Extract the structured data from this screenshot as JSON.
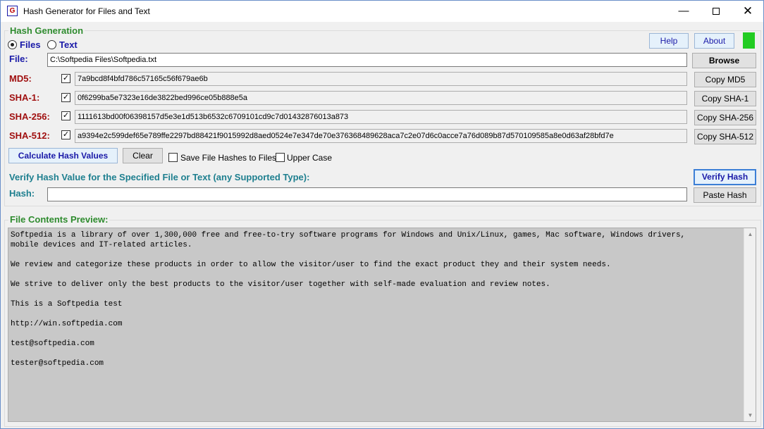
{
  "window": {
    "title": "Hash Generator for Files and Text",
    "icon_char": "G",
    "minimize": "—",
    "close": "✕"
  },
  "hash_generation": {
    "group_title": "Hash Generation",
    "mode_files": "Files",
    "mode_text": "Text",
    "help_label": "Help",
    "about_label": "About",
    "file_label": "File:",
    "file_value": "C:\\Softpedia Files\\Softpedia.txt",
    "browse_label": "Browse",
    "rows": [
      {
        "label": "MD5:",
        "checked": "✓",
        "value": "7a9bcd8f4bfd786c57165c56f679ae6b",
        "copy": "Copy MD5"
      },
      {
        "label": "SHA-1:",
        "checked": "✓",
        "value": "0f6299ba5e7323e16de3822bed996ce05b888e5a",
        "copy": "Copy SHA-1"
      },
      {
        "label": "SHA-256:",
        "checked": "✓",
        "value": "1111613bd00f06398157d5e3e1d513b6532c6709101cd9c7d01432876013a873",
        "copy": "Copy SHA-256"
      },
      {
        "label": "SHA-512:",
        "checked": "✓",
        "value": "a9394e2c599def65e789ffe2297bd88421f9015992d8aed0524e7e347de70e376368489628aca7c2e07d6c0acce7a76d089b87d570109585a8e0d63af28bfd7e",
        "copy": "Copy SHA-512"
      }
    ],
    "calculate_label": "Calculate Hash Values",
    "clear_label": "Clear",
    "save_hashes_label": "Save File Hashes to Files",
    "upper_case_label": "Upper Case",
    "verify_heading": "Verify Hash Value for the Specified File or Text (any Supported Type):",
    "verify_label": "Verify Hash",
    "hash_label": "Hash:",
    "hash_value": "",
    "paste_label": "Paste Hash"
  },
  "preview": {
    "group_title": "File Contents Preview:",
    "lines": [
      "Softpedia is a library of over 1,300,000 free and free-to-try software programs for Windows and Unix/Linux, games, Mac software, Windows drivers,",
      "mobile devices and IT-related articles.",
      "",
      "We review and categorize these products in order to allow the visitor/user to find the exact product they and their system needs.",
      "",
      "We strive to deliver only the best products to the visitor/user together with self-made evaluation and review notes.",
      "",
      "This is a Softpedia test",
      "",
      "http://win.softpedia.com",
      "",
      "test@softpedia.com",
      "",
      "tester@softpedia.com"
    ]
  },
  "colors": {
    "status_indicator": "#22cc22",
    "group_title": "#2e8b2e",
    "label_blue": "#1a1aa8",
    "label_red": "#a01010"
  }
}
